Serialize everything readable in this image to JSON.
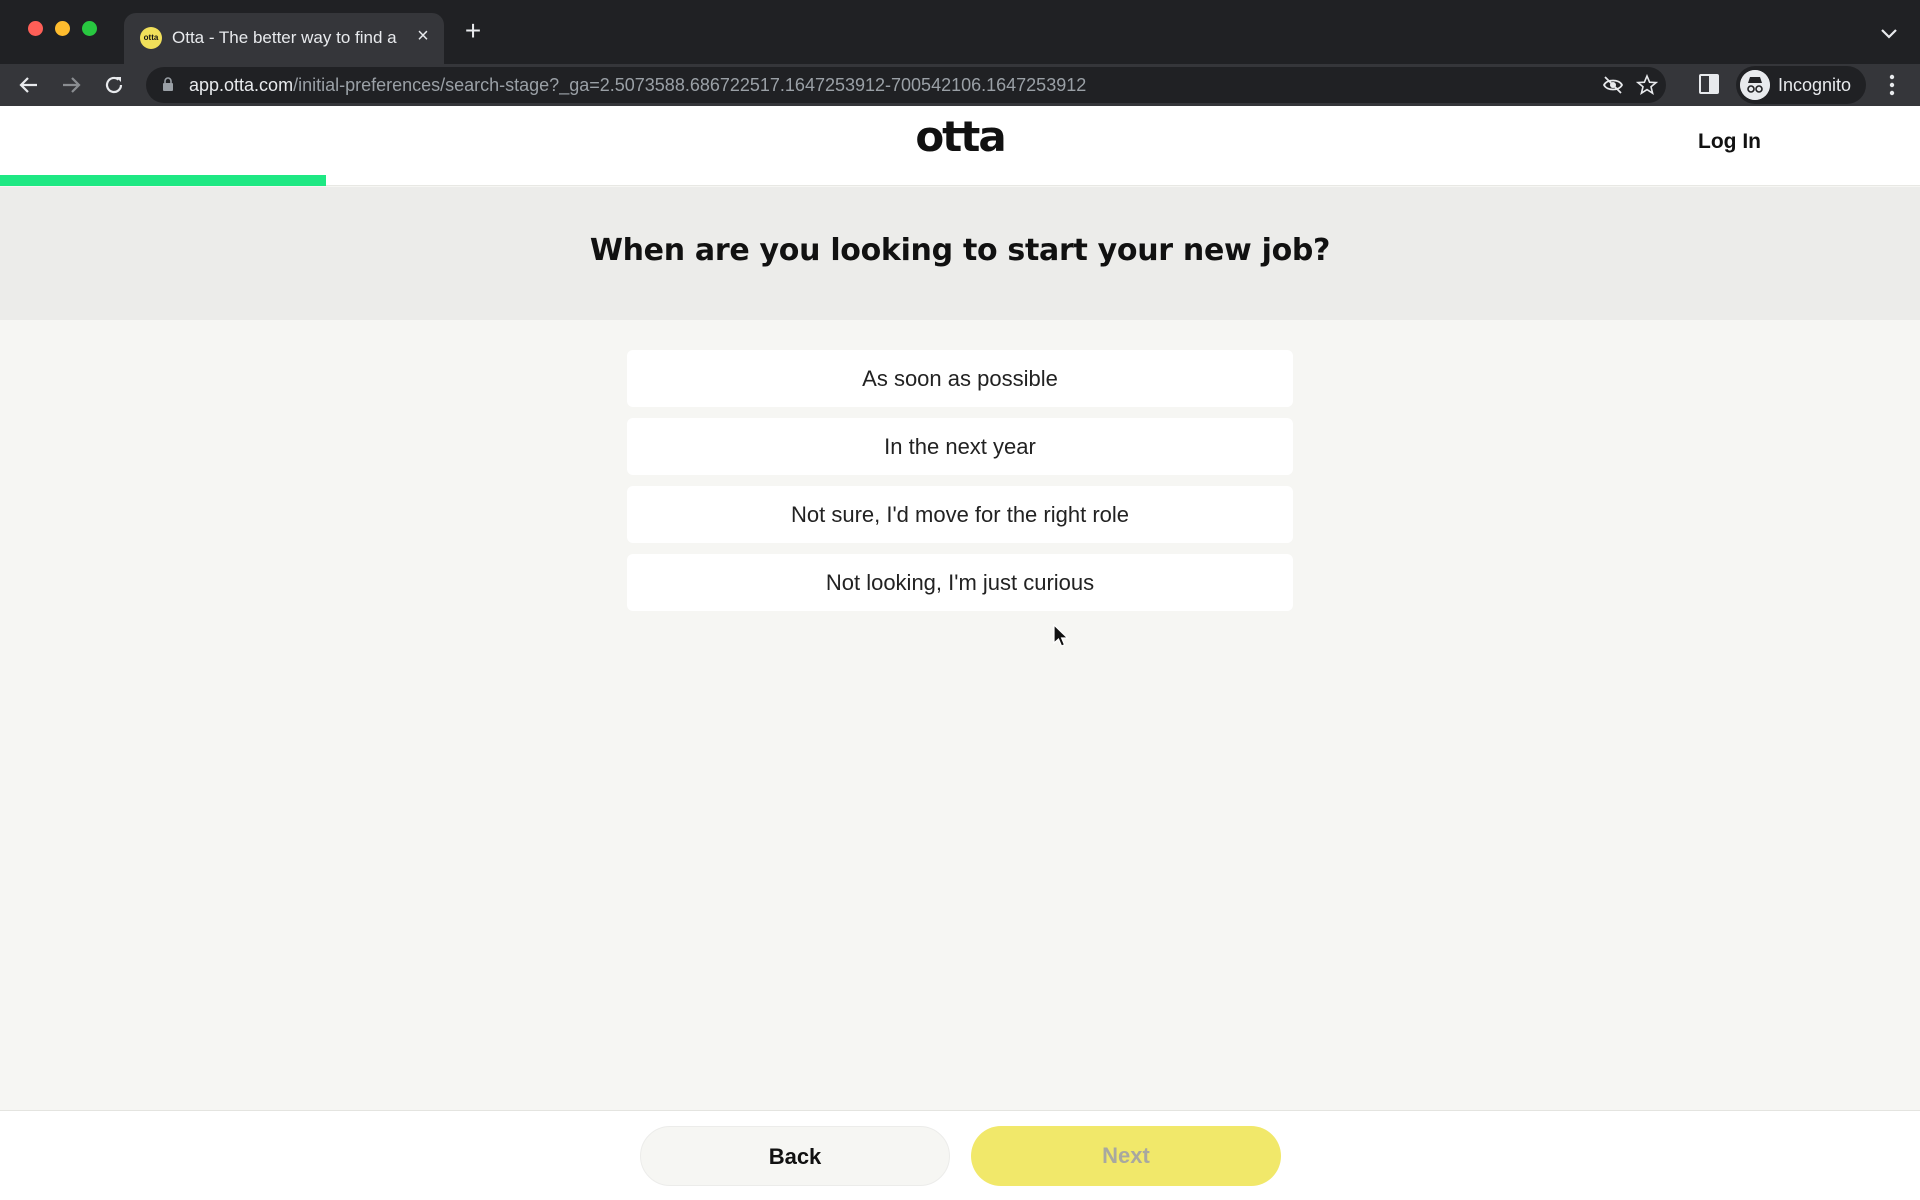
{
  "browser": {
    "tab_title": "Otta - The better way to find a",
    "tab_favicon_text": "otta",
    "url_host": "app.otta.com",
    "url_path": "/initial-preferences/search-stage?_ga=2.5073588.686722517.1647253912-700542106.1647253912",
    "profile_label": "Incognito"
  },
  "header": {
    "logo": "otta",
    "login_label": "Log In",
    "progress": 0.17
  },
  "question": {
    "title": "When are you looking to start your new job?"
  },
  "options": [
    {
      "label": "As soon as possible"
    },
    {
      "label": "In the next year"
    },
    {
      "label": "Not sure, I'd move for the right role"
    },
    {
      "label": "Not looking, I'm just curious"
    }
  ],
  "footer": {
    "back_label": "Back",
    "next_label": "Next"
  },
  "colors": {
    "progress": "#1ee883",
    "next_button": "#f1e86a"
  }
}
